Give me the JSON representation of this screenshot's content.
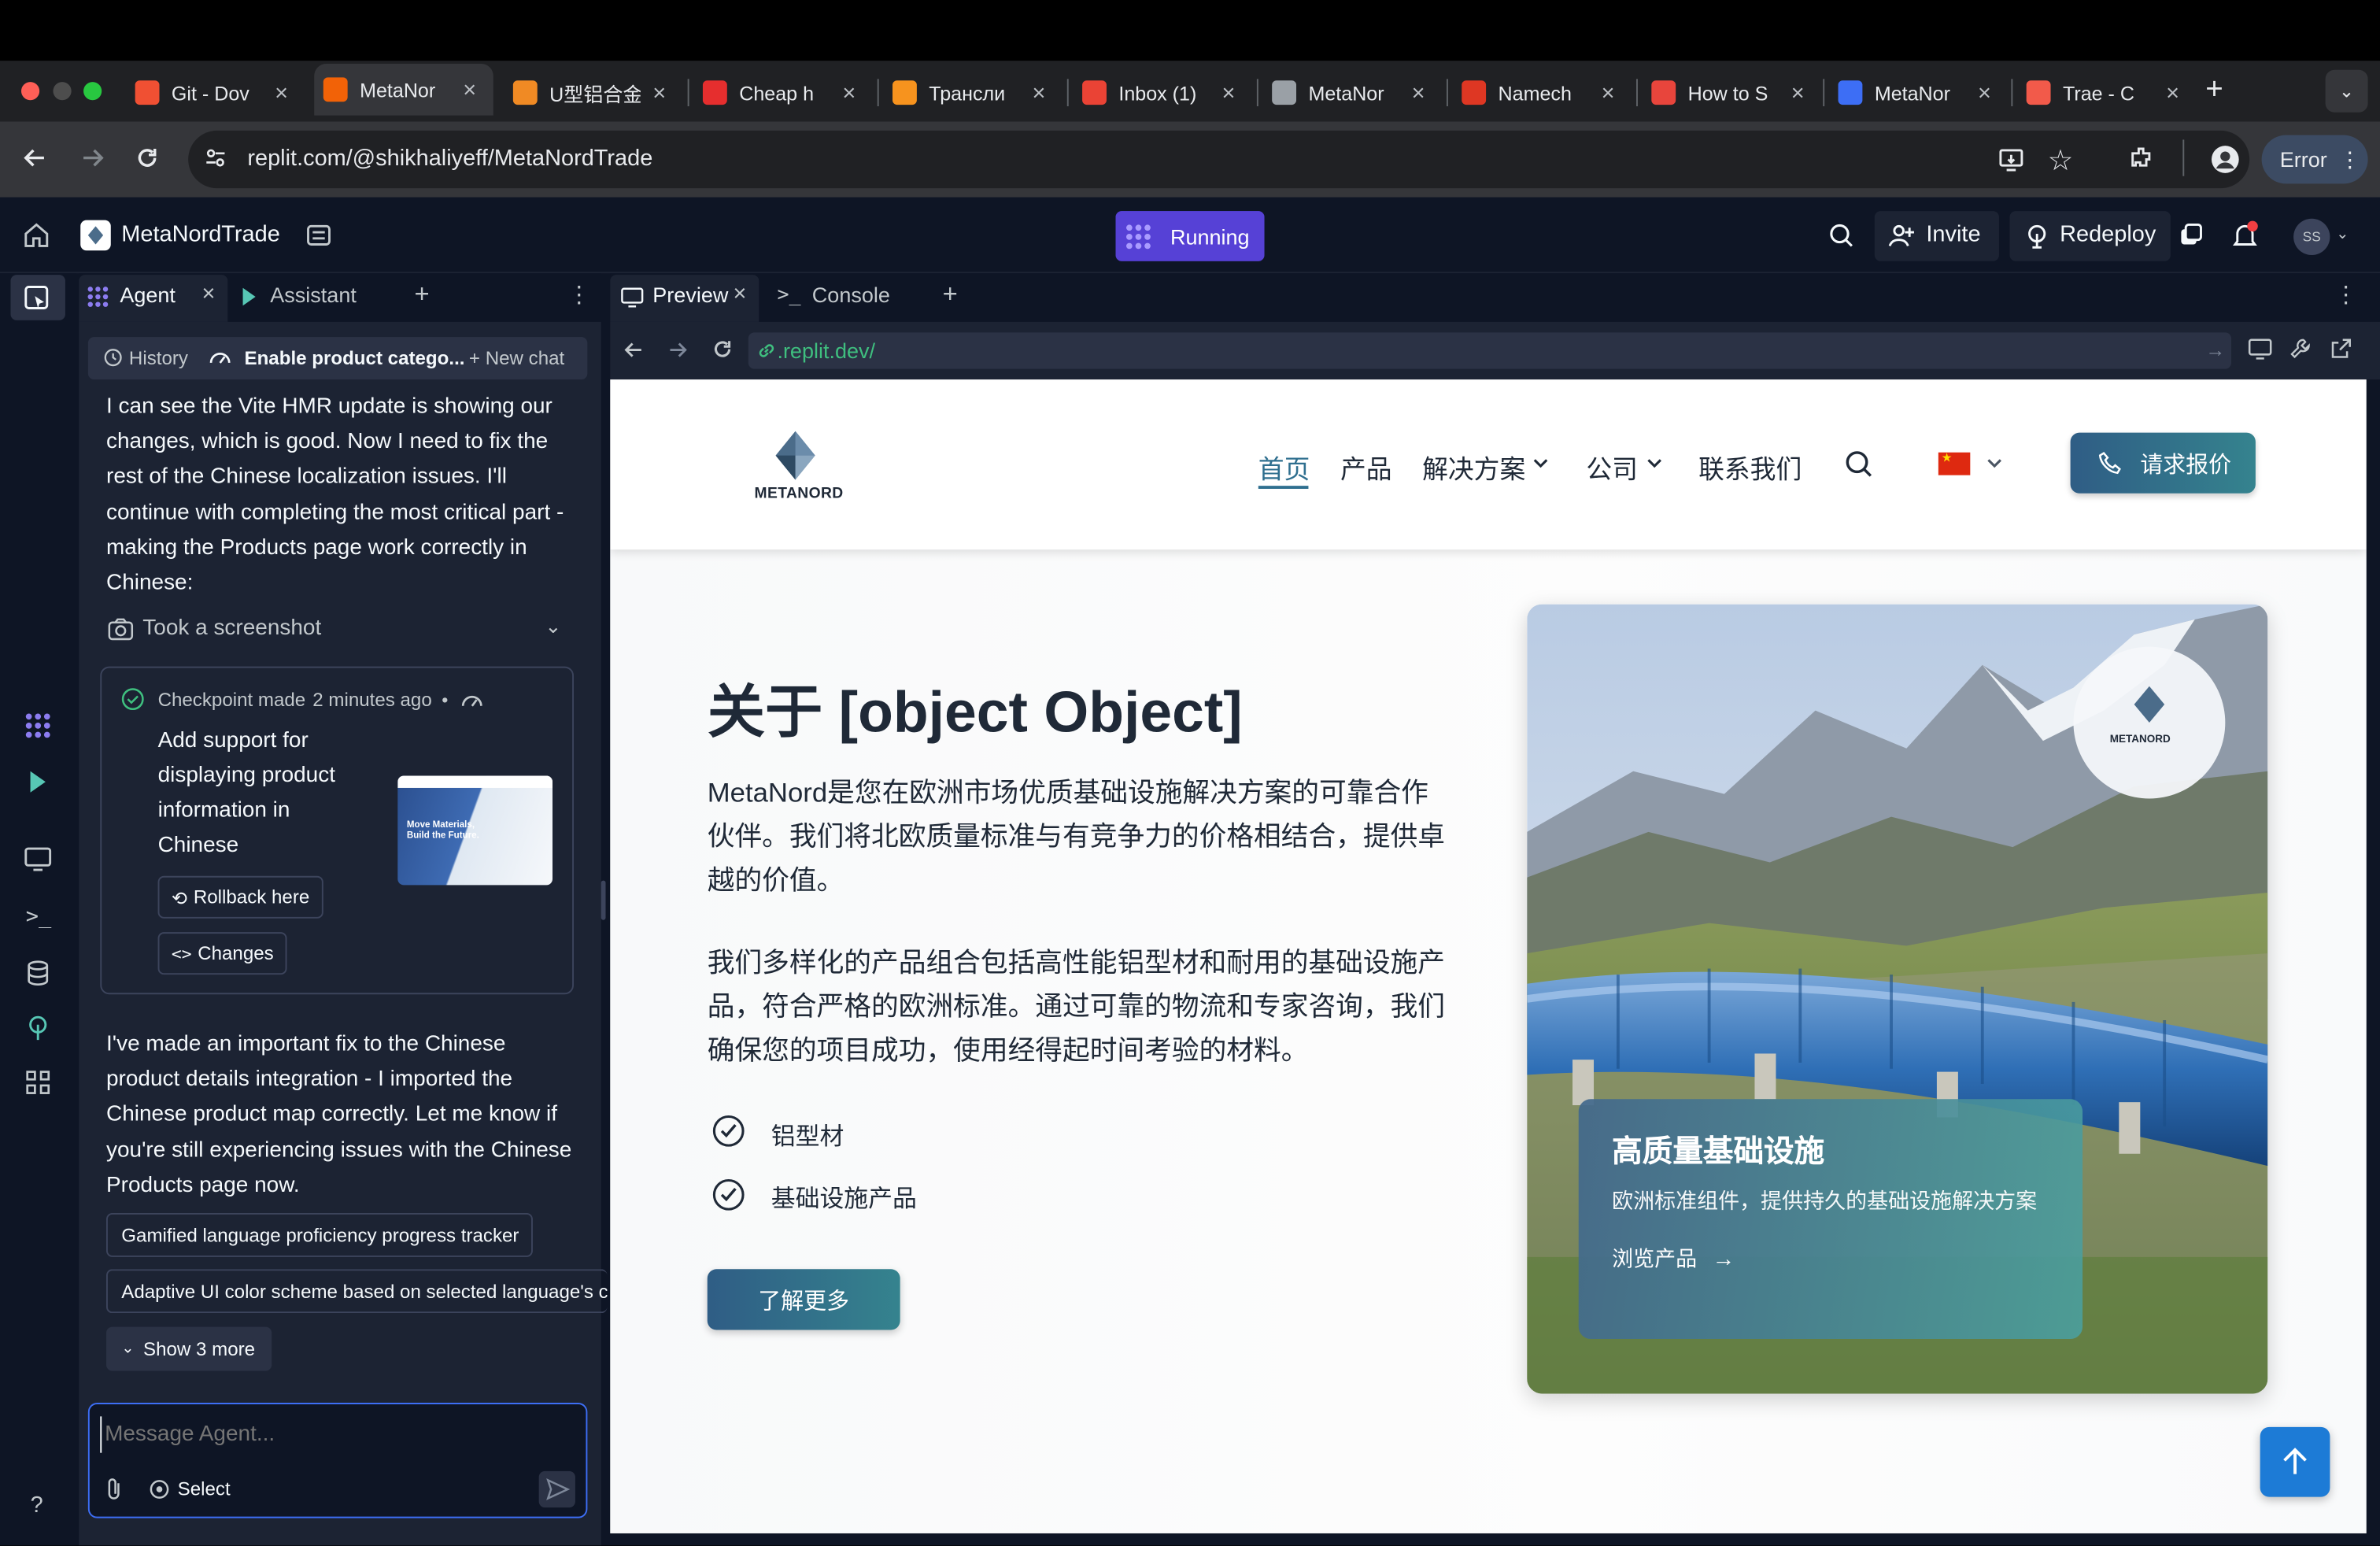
{
  "browser": {
    "tabs": [
      {
        "label": "Git - Dov",
        "color": "#f05033"
      },
      {
        "label": "MetaNor",
        "color": "#f26207",
        "active": true
      },
      {
        "label": "U型铝合金",
        "color": "#f08a24"
      },
      {
        "label": "Cheap h",
        "color": "#e62e2e"
      },
      {
        "label": "Трансли",
        "color": "#f7931e"
      },
      {
        "label": "Inbox (1)",
        "color": "#ea4335"
      },
      {
        "label": "MetaNor",
        "color": "#9aa0a6"
      },
      {
        "label": "Namech",
        "color": "#de3723"
      },
      {
        "label": "How to S",
        "color": "#e8453c"
      },
      {
        "label": "MetaNor",
        "color": "#3d6ef5"
      },
      {
        "label": "Trae - C",
        "color": "#f25a4a"
      }
    ],
    "url": "replit.com/@shikhaliyeff/MetaNordTrade",
    "error_label": "Error"
  },
  "replit": {
    "project_name": "MetaNordTrade",
    "run_label": "Running",
    "invite_label": "Invite",
    "redeploy_label": "Redeploy",
    "avatar_initials": "SS"
  },
  "agent_panel": {
    "tab_agent": "Agent",
    "tab_assistant": "Assistant",
    "history_label": "History",
    "chat_title": "Enable product catego...",
    "new_chat_label": "+ New chat",
    "message_1": "I can see the Vite HMR update is showing our changes, which is good. Now I need to fix the rest of the Chinese localization issues. I'll continue with completing the most critical part - making the Products page work correctly in Chinese:",
    "screenshot_label": "Took a screenshot",
    "checkpoint_label": "Checkpoint made",
    "checkpoint_time": "2 minutes ago",
    "checkpoint_title": "Add support for displaying product information in Chinese",
    "thumb_text": "Move Materials, Build the Future.",
    "rollback_label": "Rollback here",
    "changes_label": "Changes",
    "message_2": "I've made an important fix to the Chinese product details integration - I imported the Chinese product map correctly. Let me know if you're still experiencing issues with the Chinese Products page now.",
    "suggestions": [
      "Gamified language proficiency progress tracker",
      "Adaptive UI color scheme based on selected language's c"
    ],
    "show_more_label": "Show 3 more",
    "input_placeholder": "Message Agent...",
    "select_label": "Select"
  },
  "preview_panel": {
    "tab_preview": "Preview",
    "tab_console": "Console",
    "url": ".replit.dev/"
  },
  "site": {
    "logo_text": "METANORD",
    "nav": {
      "home": "首页",
      "products": "产品",
      "solutions": "解决方案",
      "company": "公司",
      "contact": "联系我们"
    },
    "cta_label": "请求报价",
    "hero_title": "关于 [object Object]",
    "paragraph_1": "MetaNord是您在欧洲市场优质基础设施解决方案的可靠合作伙伴。我们将北欧质量标准与有竞争力的价格相结合，提供卓越的价值。",
    "paragraph_2": "我们多样化的产品组合包括高性能铝型材和耐用的基础设施产品，符合严格的欧洲标准。通过可靠的物流和专家咨询，我们确保您的项目成功，使用经得起时间考验的材料。",
    "features": [
      "铝型材",
      "基础设施产品"
    ],
    "learn_more_label": "了解更多",
    "card_logo_text": "METANORD",
    "card_title": "高质量基础设施",
    "card_desc": "欧洲标准组件，提供持久的基础设施解决方案",
    "card_link": "浏览产品"
  },
  "colors": {
    "accent": "#2f5d85",
    "teal": "#35838e",
    "replit_purple": "#5641d6",
    "replit_bg": "#0e1525"
  }
}
